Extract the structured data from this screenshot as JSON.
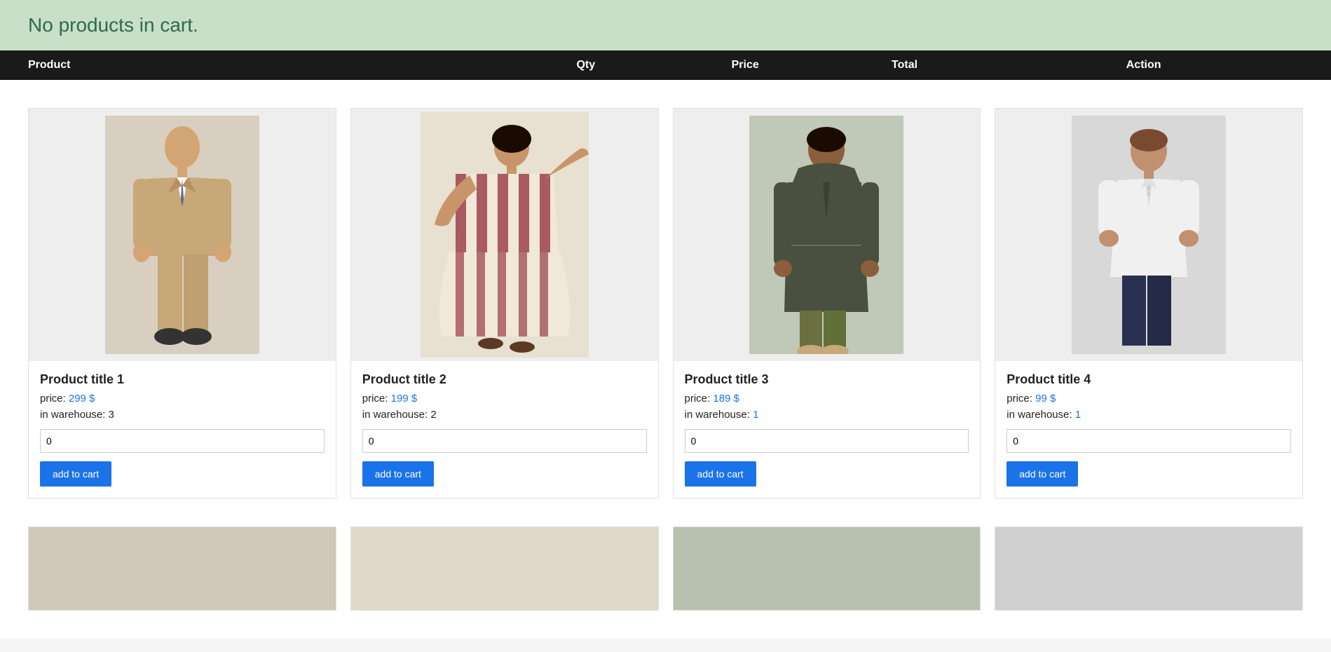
{
  "cart_notice": "No products in cart.",
  "table_header": {
    "product": "Product",
    "qty": "Qty",
    "price": "Price",
    "total": "Total",
    "action": "Action"
  },
  "products": [
    {
      "id": 1,
      "title": "Product title 1",
      "price_label": "price:",
      "price_value": "299 $",
      "warehouse_label": "in warehouse:",
      "warehouse_value": "3",
      "warehouse_low": false,
      "qty": "0",
      "btn_label": "add to cart",
      "bg_color": "#d8cfc0",
      "figure_type": "suit"
    },
    {
      "id": 2,
      "title": "Product title 2",
      "price_label": "price:",
      "price_value": "199 $",
      "warehouse_label": "in warehouse:",
      "warehouse_value": "2",
      "warehouse_low": false,
      "qty": "0",
      "btn_label": "add to cart",
      "bg_color": "#e8e0d0",
      "figure_type": "dress"
    },
    {
      "id": 3,
      "title": "Product title 3",
      "price_label": "price:",
      "price_value": "189 $",
      "warehouse_label": "in warehouse:",
      "warehouse_value": "1",
      "warehouse_low": true,
      "qty": "0",
      "btn_label": "add to cart",
      "bg_color": "#c0c8b8",
      "figure_type": "coat"
    },
    {
      "id": 4,
      "title": "Product title 4",
      "price_label": "price:",
      "price_value": "99 $",
      "warehouse_label": "in warehouse:",
      "warehouse_value": "1",
      "warehouse_low": true,
      "qty": "0",
      "btn_label": "add to cart",
      "bg_color": "#d8d8d8",
      "figure_type": "polo"
    }
  ],
  "bottom_cards": [
    {
      "bg": "#d0c8b8"
    },
    {
      "bg": "#e0d8c8"
    },
    {
      "bg": "#b8c0b0"
    },
    {
      "bg": "#d0d0d0"
    }
  ]
}
